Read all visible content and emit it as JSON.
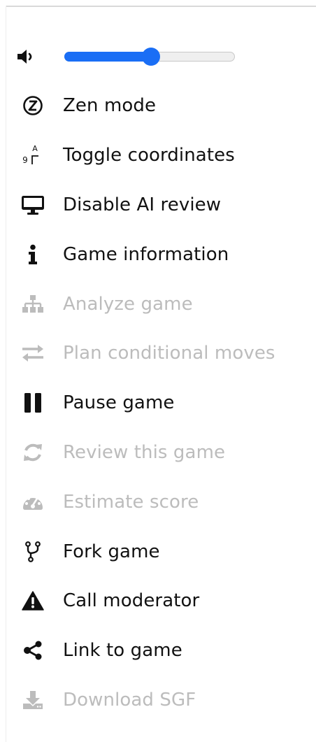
{
  "colors": {
    "text": "#111111",
    "disabled": "#bcbcbc",
    "accent": "#1a6ef5",
    "track": "#efefef"
  },
  "volume": {
    "icon": "volume-icon",
    "level_percent": 51
  },
  "menu_items": [
    {
      "id": "zen-mode",
      "label": "Zen mode",
      "icon": "zen-circle-z-icon",
      "disabled": false
    },
    {
      "id": "toggle-coordinates",
      "label": "Toggle coordinates",
      "icon": "coordinates-icon",
      "disabled": false
    },
    {
      "id": "disable-ai-review",
      "label": "Disable AI review",
      "icon": "desktop-monitor-icon",
      "disabled": false
    },
    {
      "id": "game-information",
      "label": "Game information",
      "icon": "info-icon",
      "disabled": false
    },
    {
      "id": "analyze-game",
      "label": "Analyze game",
      "icon": "sitemap-icon",
      "disabled": true
    },
    {
      "id": "plan-conditional-moves",
      "label": "Plan conditional moves",
      "icon": "exchange-arrows-icon",
      "disabled": true
    },
    {
      "id": "pause-game",
      "label": "Pause game",
      "icon": "pause-icon",
      "disabled": false
    },
    {
      "id": "review-this-game",
      "label": "Review this game",
      "icon": "refresh-icon",
      "disabled": true
    },
    {
      "id": "estimate-score",
      "label": "Estimate score",
      "icon": "tachometer-icon",
      "disabled": true
    },
    {
      "id": "fork-game",
      "label": "Fork game",
      "icon": "code-fork-icon",
      "disabled": false
    },
    {
      "id": "call-moderator",
      "label": "Call moderator",
      "icon": "warning-triangle-icon",
      "disabled": false
    },
    {
      "id": "link-to-game",
      "label": "Link to game",
      "icon": "share-icon",
      "disabled": false
    },
    {
      "id": "download-sgf",
      "label": "Download SGF",
      "icon": "download-icon",
      "disabled": true
    }
  ]
}
